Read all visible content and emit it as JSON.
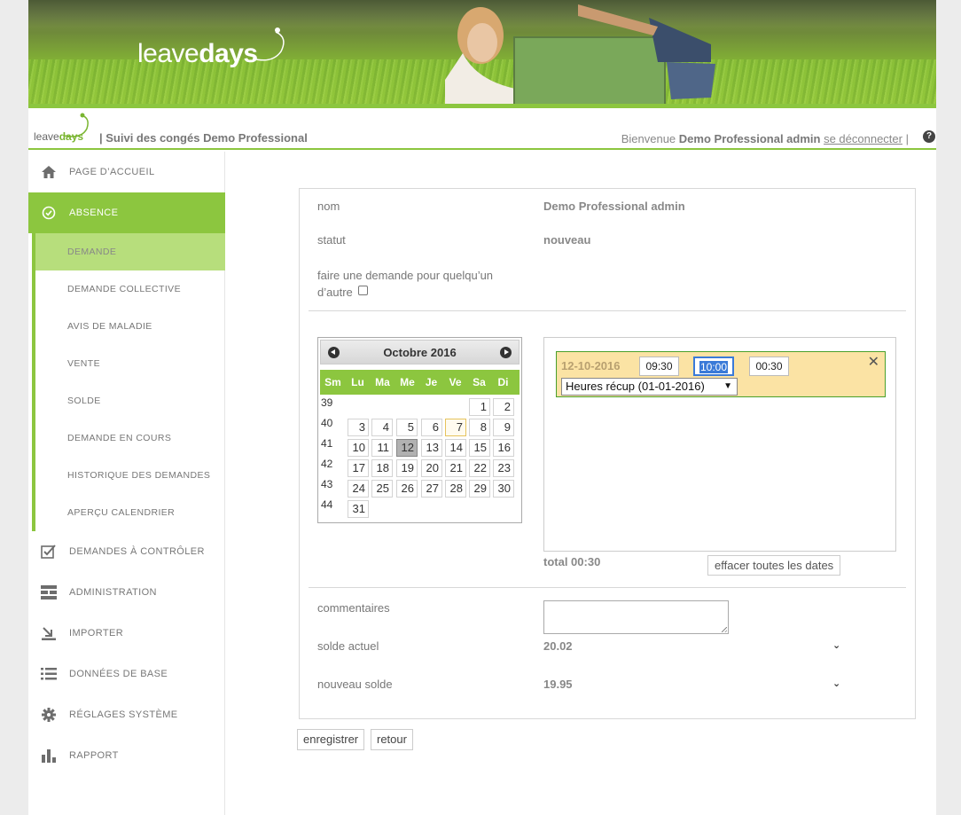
{
  "banner": {
    "logo_light": "leave",
    "logo_bold": "days"
  },
  "header": {
    "logo_light": "leave",
    "logo_bold": "days",
    "title": "| Suivi des congés Demo Professional",
    "welcome_prefix": "Bienvenue",
    "user_name": "Demo Professional admin",
    "logout_label": "se déconnecter",
    "separator": "|",
    "help_icon": "?"
  },
  "sidebar": {
    "home": {
      "label": "PAGE D’ACCUEIL",
      "icon": "home-icon"
    },
    "absence": {
      "label": "ABSENCE",
      "icon": "check-circle-icon"
    },
    "absence_items": [
      "DEMANDE",
      "DEMANDE COLLECTIVE",
      "AVIS DE MALADIE",
      "VENTE",
      "SOLDE",
      "DEMANDE EN COURS",
      "HISTORIQUE DES DEMANDES",
      "APERÇU CALENDRIER"
    ],
    "items": [
      {
        "label": "DEMANDES À CONTRÔLER",
        "icon": "checkbox-icon"
      },
      {
        "label": "ADMINISTRATION",
        "icon": "admin-icon"
      },
      {
        "label": "IMPORTER",
        "icon": "import-icon"
      },
      {
        "label": "DONNÉES DE BASE",
        "icon": "list-icon"
      },
      {
        "label": "RÉGLAGES SYSTÈME",
        "icon": "gear-icon"
      },
      {
        "label": "RAPPORT",
        "icon": "bar-chart-icon"
      }
    ]
  },
  "form": {
    "name_label": "nom",
    "name_value": "Demo Professional admin",
    "status_label": "statut",
    "status_value": "nouveau",
    "other_label_1": "faire une demande pour quelqu’un",
    "other_label_2": "d’autre",
    "comment_label": "commentaires",
    "balance_label": "solde actuel",
    "balance_value": "20.02",
    "new_balance_label": "nouveau solde",
    "new_balance_value": "19.95"
  },
  "calendar": {
    "month_label": "Octobre 2016",
    "dow": [
      "Sm",
      "Lu",
      "Ma",
      "Me",
      "Je",
      "Ve",
      "Sa",
      "Di"
    ],
    "weeks": [
      {
        "week": "39",
        "days": [
          "",
          "",
          "",
          "",
          "",
          "1",
          "2"
        ]
      },
      {
        "week": "40",
        "days": [
          "3",
          "4",
          "5",
          "6",
          "7",
          "8",
          "9"
        ]
      },
      {
        "week": "41",
        "days": [
          "10",
          "11",
          "12",
          "13",
          "14",
          "15",
          "16"
        ]
      },
      {
        "week": "42",
        "days": [
          "17",
          "18",
          "19",
          "20",
          "21",
          "22",
          "23"
        ]
      },
      {
        "week": "43",
        "days": [
          "24",
          "25",
          "26",
          "27",
          "28",
          "29",
          "30"
        ]
      },
      {
        "week": "44",
        "days": [
          "31",
          "",
          "",
          "",
          "",
          "",
          ""
        ]
      }
    ],
    "today": "7",
    "selected": "12"
  },
  "dates": {
    "entry_date": "12-10-2016",
    "start_time": "09:30",
    "end_time": "10:00",
    "duration": "00:30",
    "close_label": "✕",
    "type_value": "Heures récup (01-01-2016)",
    "total_label": "total 00:30",
    "clear_label": "effacer toutes les dates"
  },
  "actions": {
    "save_label": "enregistrer",
    "back_label": "retour"
  }
}
